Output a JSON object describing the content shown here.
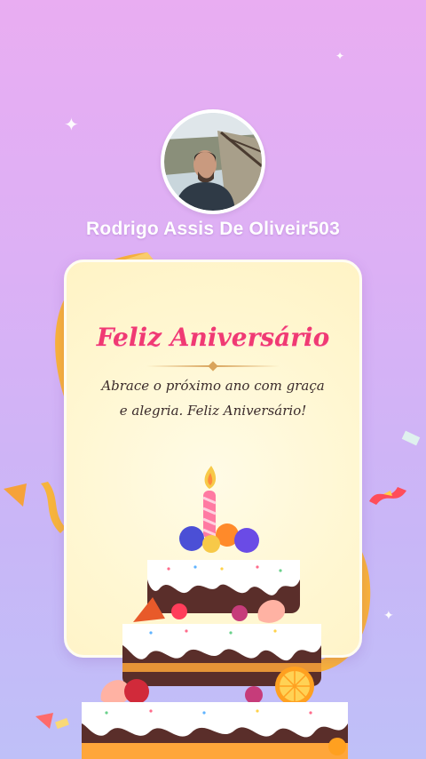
{
  "profile": {
    "username": "Rodrigo Assis De Oliveir503"
  },
  "card": {
    "title": "Feliz Aniversário",
    "message": "Abrace o próximo ano com graça e alegria. Feliz Aniversário!"
  },
  "colors": {
    "background_top": "#e9adf2",
    "background_bottom": "#bfc0f8",
    "title": "#f03a73",
    "card": "#fff7d2",
    "ribbon": "#f9b23a"
  },
  "icons": [
    "sparkle-icon",
    "confetti-icon",
    "birthday-cake-icon",
    "ribbon-icon"
  ]
}
